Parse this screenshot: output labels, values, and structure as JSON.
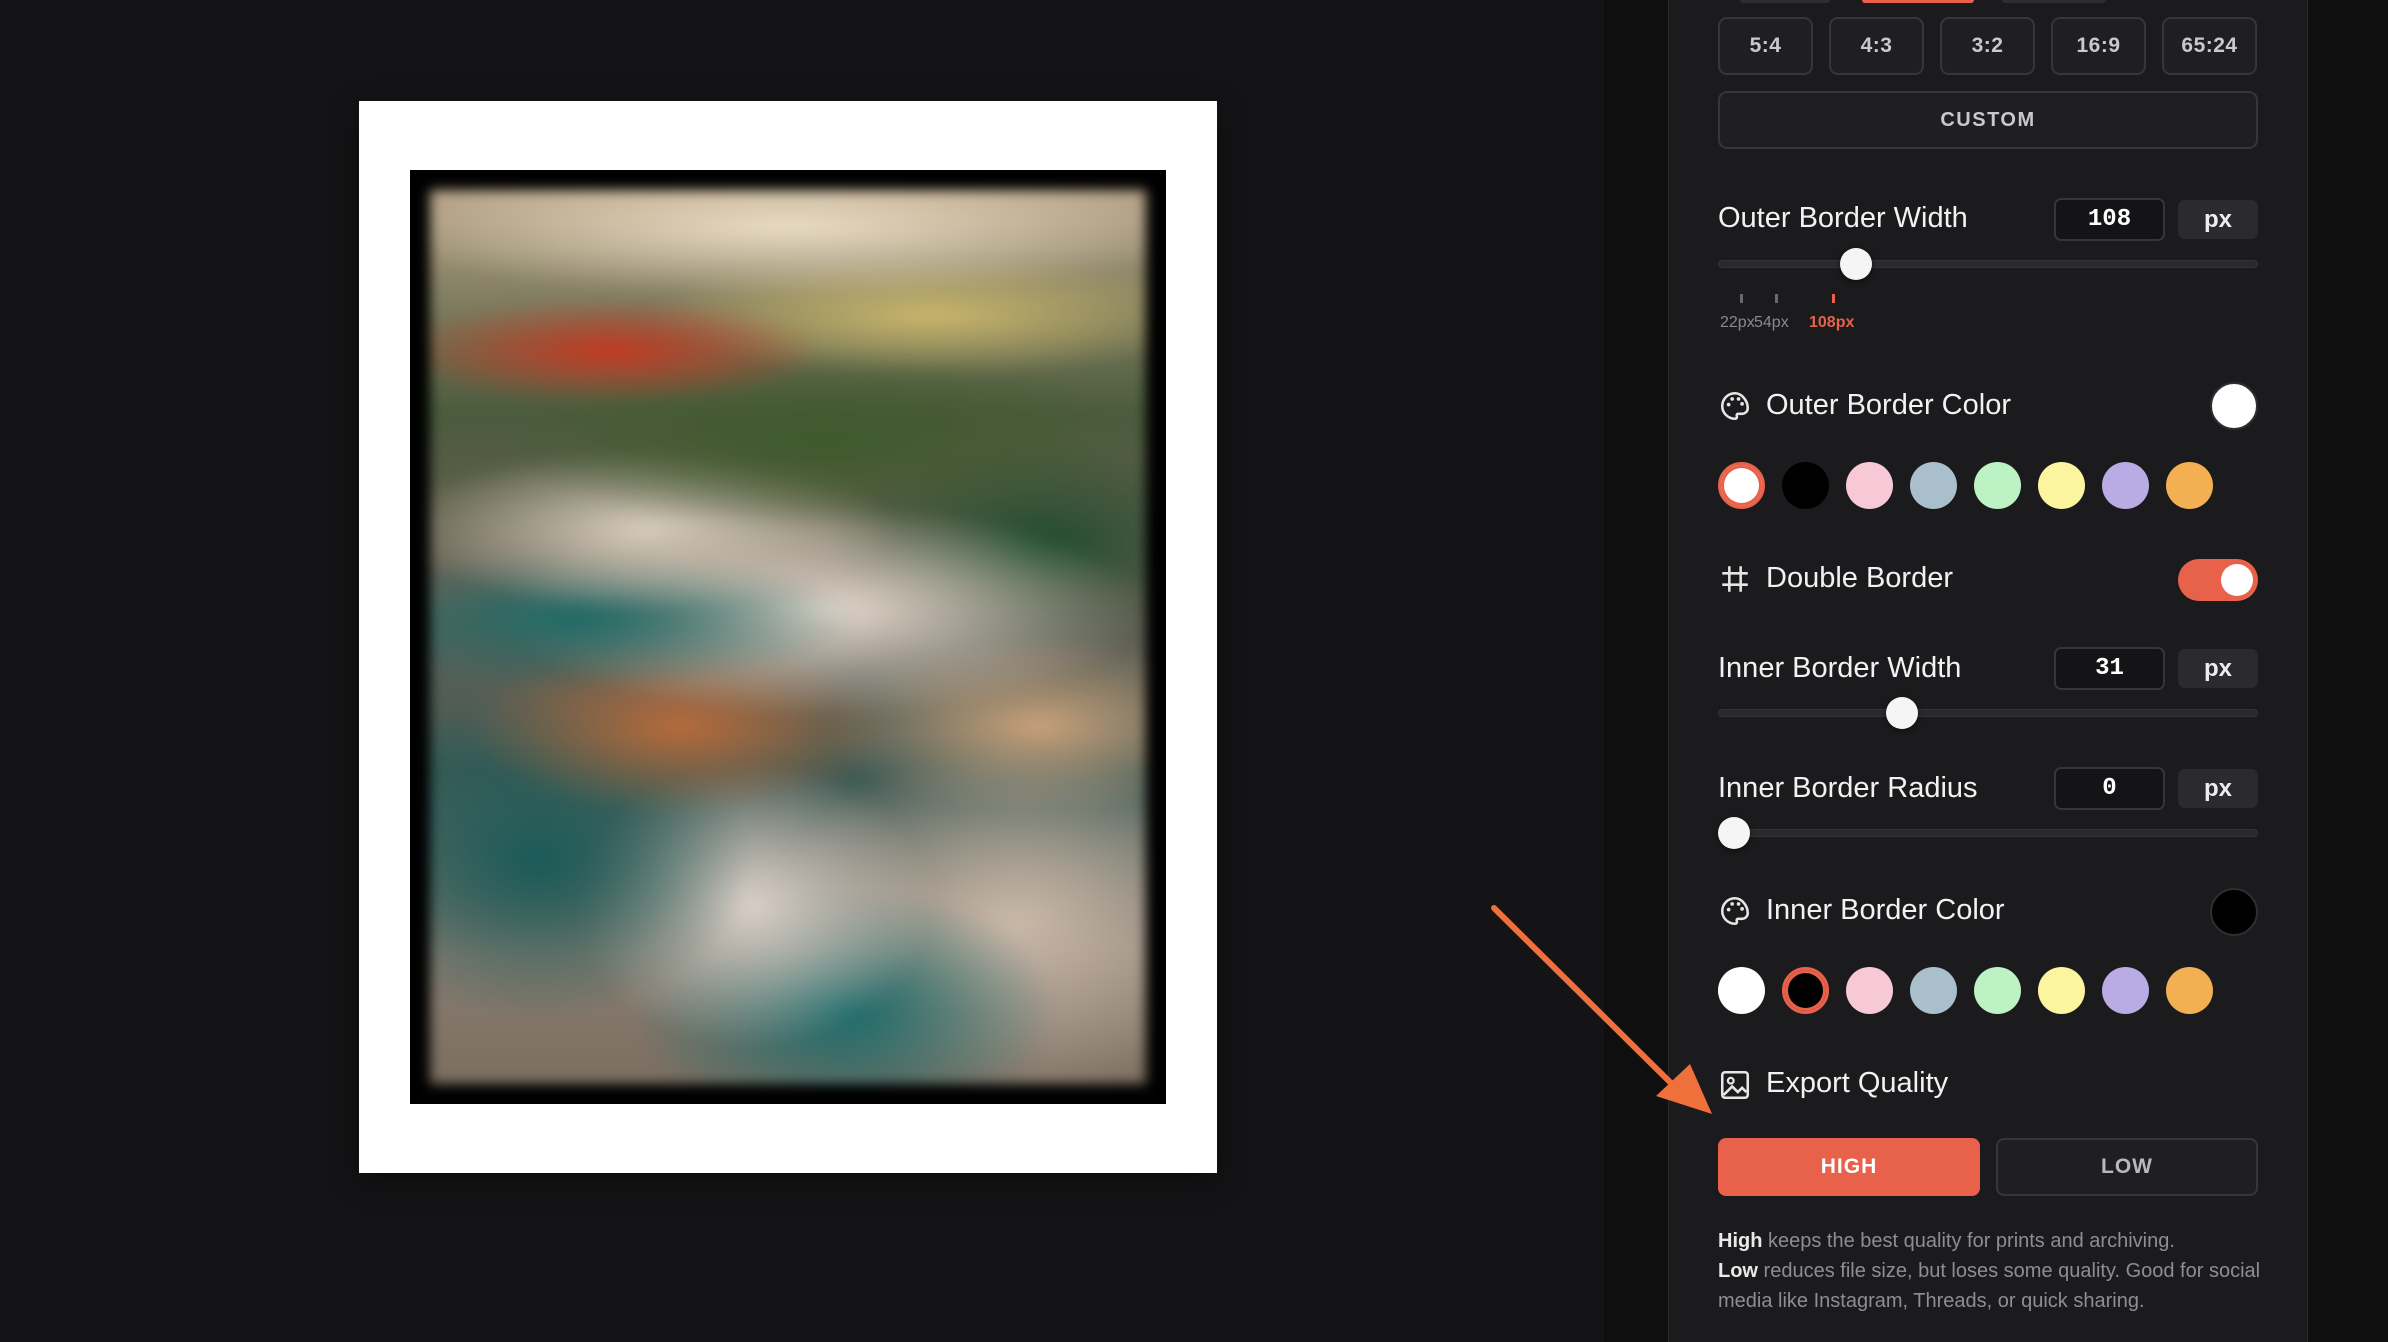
{
  "aspect_ratios": [
    "5:4",
    "4:3",
    "3:2",
    "16:9",
    "65:24"
  ],
  "custom_label": "CUSTOM",
  "outer_border_width": {
    "label": "Outer Border Width",
    "value": "108",
    "unit": "px",
    "slider_fraction": 0.24,
    "presets": [
      "22px",
      "54px",
      "108px"
    ],
    "active_preset": "108px"
  },
  "outer_border_color": {
    "label": "Outer Border Color",
    "current": "#ffffff",
    "swatches": [
      "#ffffff",
      "#000000",
      "#f7c9d6",
      "#a9bfcc",
      "#bdf2c4",
      "#fbf5a0",
      "#b9abe3",
      "#f3b052"
    ],
    "selected_index": 0
  },
  "double_border": {
    "label": "Double Border",
    "enabled": true
  },
  "inner_border_width": {
    "label": "Inner Border Width",
    "value": "31",
    "unit": "px",
    "slider_fraction": 0.33
  },
  "inner_border_radius": {
    "label": "Inner Border Radius",
    "value": "0",
    "unit": "px",
    "slider_fraction": 0.0
  },
  "inner_border_color": {
    "label": "Inner Border Color",
    "current": "#000000",
    "swatches": [
      "#ffffff",
      "#000000",
      "#f7c9d6",
      "#a9bfcc",
      "#bdf2c4",
      "#fbf5a0",
      "#b9abe3",
      "#f3b052"
    ],
    "selected_index": 1
  },
  "export_quality": {
    "label": "Export Quality",
    "high_label": "HIGH",
    "low_label": "LOW",
    "selected": "HIGH",
    "help_high_term": "High",
    "help_high_text": " keeps the best quality for prints and archiving.",
    "help_low_term": "Low",
    "help_low_text": " reduces file size, but loses some quality. Good for social media like Instagram, Threads, or quick sharing."
  },
  "colors": {
    "accent": "#e8614a",
    "annotation_arrow": "#f0703c"
  }
}
